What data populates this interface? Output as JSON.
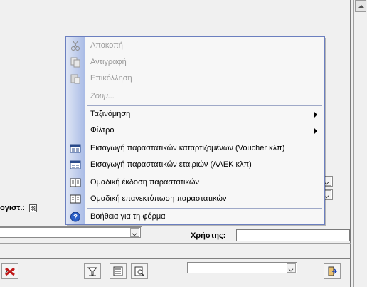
{
  "menu": {
    "items": [
      {
        "label": "Αποκοπή",
        "icon": "scissors-icon",
        "disabled": true
      },
      {
        "label": "Αντιγραφή",
        "icon": "copy-icon",
        "disabled": true
      },
      {
        "label": "Επικόλληση",
        "icon": "paste-icon",
        "disabled": true
      },
      {
        "label": "Ζουμ...",
        "disabled": true
      },
      {
        "label": "Ταξινόμηση",
        "submenu": true
      },
      {
        "label": "Φίλτρο",
        "submenu": true
      },
      {
        "label": "Εισαγωγή παραστατικών καταρτιζομένων (Voucher κλπ)",
        "icon": "form-entry-icon"
      },
      {
        "label": "Εισαγωγή παραστατικών εταιριών (ΛΑΕΚ κλπ)",
        "icon": "form-entry-icon"
      },
      {
        "label": "Ομαδική έκδοση παραστατικών",
        "icon": "book-icon"
      },
      {
        "label": "Ομαδική επανεκτύπωση παραστατικών",
        "icon": "book-icon"
      },
      {
        "label": "Βοήθεια για τη φόρμα",
        "icon": "help-icon"
      }
    ]
  },
  "form": {
    "partial_label": "ογιστ.:",
    "user_label": "Χρήστης:",
    "user_value": ""
  },
  "colors": {
    "menu_border": "#6b7fbf",
    "gutter_start": "#dfe6f5",
    "gutter_end": "#a9bbe6",
    "delete_icon": "#c01818",
    "help_icon": "#2a5fc8"
  }
}
